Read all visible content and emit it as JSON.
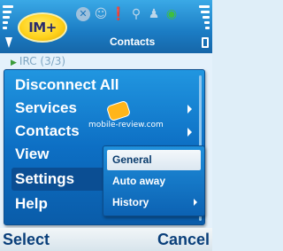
{
  "app": {
    "logo_text": "IM+",
    "title": "Contacts"
  },
  "status_icons": [
    "cross-icon",
    "smiley-icon",
    "exclamation-icon",
    "person-walking-icon",
    "person-icon",
    "eye-icon"
  ],
  "background": {
    "contact_row": "IRC (3/3)"
  },
  "menu": {
    "items": [
      {
        "label": "Disconnect All",
        "has_submenu": false
      },
      {
        "label": "Services",
        "has_submenu": true
      },
      {
        "label": "Contacts",
        "has_submenu": true
      },
      {
        "label": "View",
        "has_submenu": false
      },
      {
        "label": "Settings",
        "has_submenu": true,
        "selected": true
      },
      {
        "label": "Help",
        "has_submenu": false
      }
    ]
  },
  "submenu": {
    "items": [
      {
        "label": "General",
        "selected": true
      },
      {
        "label": "Auto away"
      },
      {
        "label": "History",
        "has_submenu": true
      }
    ]
  },
  "watermark": {
    "text": "mobile-review.com"
  },
  "softkeys": {
    "left": "Select",
    "right": "Cancel"
  },
  "colors": {
    "menu_bg": "#0d6fc4",
    "highlight": "#0b4e93",
    "softkey_text": "#0a3f7a",
    "logo_yellow": "#ffd21c"
  }
}
